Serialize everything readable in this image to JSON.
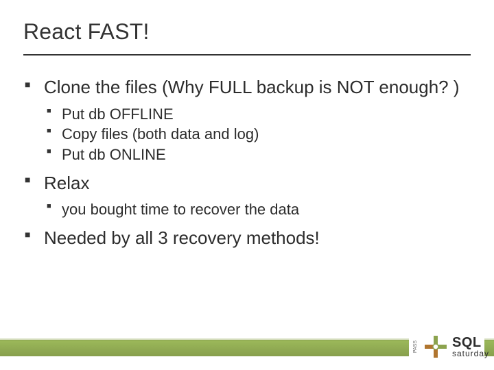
{
  "title": "React FAST!",
  "bullets": {
    "l1_0": "Clone the files (Why FULL backup is NOT enough? )",
    "l1_0_sub": {
      "s0": "Put db OFFLINE",
      "s1": "Copy files (both data and log)",
      "s2": "Put db ONLINE"
    },
    "l1_1": "Relax",
    "l1_1_sub": {
      "s0": "you bought time to recover the data"
    },
    "l1_2": "Needed by all 3 recovery methods!"
  },
  "footer_logo": {
    "pass": "PASS",
    "sql": "SQL",
    "saturday": "saturday"
  },
  "colors": {
    "accent_green": "#8ca34e",
    "text_dark": "#2c2c2c"
  }
}
